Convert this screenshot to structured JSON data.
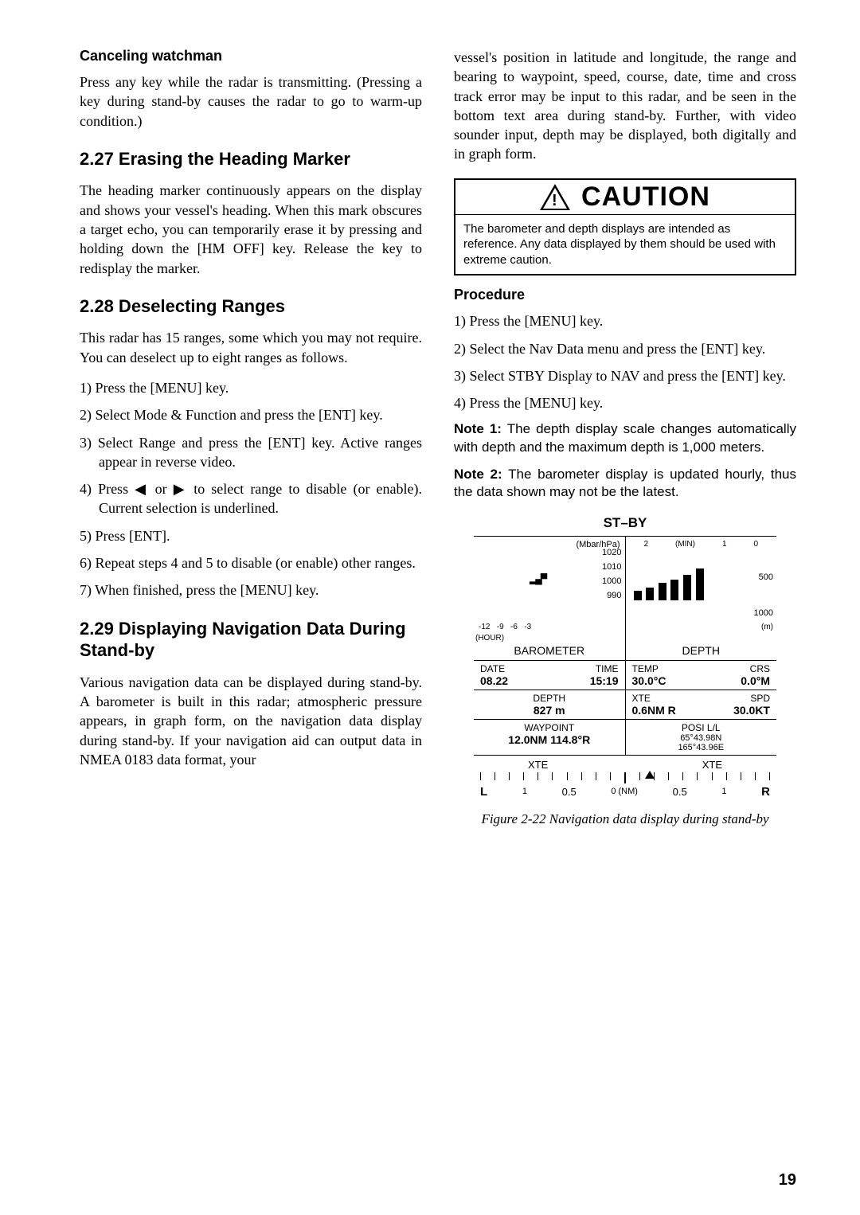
{
  "page_number": "19",
  "left": {
    "h_cancel": "Canceling watchman",
    "p_cancel": "Press any key while the radar is transmitting. (Pressing a key during stand-by causes the radar to go to warm-up condition.)",
    "h_227": "2.27 Erasing the Heading Marker",
    "p_227": "The heading marker continuously appears on the display and shows your vessel's heading. When this mark obscures a target echo, you can temporarily erase it by pressing and holding down the [HM OFF] key. Release the key to redisplay the marker.",
    "h_228": "2.28 Deselecting Ranges",
    "p_228": "This radar has 15 ranges, some which you may not require. You can deselect up to eight ranges as follows.",
    "li1": "1) Press the [MENU] key.",
    "li2": "2) Select Mode & Function and press the [ENT] key.",
    "li3": "3) Select Range and press the [ENT] key. Active ranges appear in reverse video.",
    "li4a": "4) Press ",
    "li4b": " or ",
    "li4c": " to select range to disable (or enable). Current selection is underlined.",
    "arrow_l": "◀",
    "arrow_r": "▶",
    "li5": "5) Press [ENT].",
    "li6": "6) Repeat steps 4 and 5 to disable (or enable) other ranges.",
    "li7": "7) When finished, press the [MENU] key.",
    "h_229": "2.29 Displaying Navigation Data During Stand-by",
    "p_229": "Various navigation data can be displayed during stand-by. A barometer is built in this radar; atmospheric pressure appears, in graph form, on the navigation data display during stand-by. If your navigation aid can output data in NMEA 0183 data format, your"
  },
  "right": {
    "p_cont": "vessel's position in latitude and longitude, the range and bearing to waypoint, speed, course, date, time and cross track error may be input to this radar, and be seen in the bottom text area during stand-by. Further, with video sounder input, depth may be displayed, both digitally and in graph form.",
    "caution_word": "CAUTION",
    "caution_body": "The barometer and depth displays are intended as reference. Any data displayed by them should be used with extreme caution.",
    "h_proc": "Procedure",
    "li1": "1) Press the [MENU] key.",
    "li2": "2) Select the Nav Data menu and press the [ENT] key.",
    "li3": "3) Select STBY Display to NAV and press the [ENT] key.",
    "li4": "4) Press the [MENU] key.",
    "note1_b": "Note 1:",
    "note1": " The depth display scale changes automatically with depth and the maximum depth is 1,000 meters.",
    "note2_b": "Note 2:",
    "note2": " The barometer display is updated hourly, thus the data shown may not be the latest.",
    "fig_title": "ST–BY",
    "caption": "Figure 2-22 Navigation data display during stand-by"
  },
  "nav": {
    "baro_unit": "(Mbar/hPa)",
    "baro_y": [
      "1020",
      "1010",
      "1000",
      "990"
    ],
    "baro_x": [
      "-12",
      "-9",
      "-6",
      "-3"
    ],
    "baro_hour": "(HOUR)",
    "baro_label": "BAROMETER",
    "depth_unit_top": "(MIN)",
    "depth_x": [
      "2",
      "1",
      "0"
    ],
    "depth_y": [
      "500",
      "1000"
    ],
    "depth_m": "(m)",
    "depth_label": "DEPTH",
    "row1": {
      "l1": "DATE",
      "l2": "TIME",
      "v1": "08.22",
      "v2": "15:19",
      "r1": "TEMP",
      "r2": "CRS",
      "rv1": "30.0°C",
      "rv2": "0.0°M"
    },
    "row2": {
      "l": "DEPTH",
      "v": "827 m",
      "r1": "XTE",
      "r2": "SPD",
      "rv1": "0.6NM R",
      "rv2": "30.0KT"
    },
    "row3": {
      "l": "WAYPOINT",
      "v": "12.0NM   114.8°R",
      "r1": "POSI   L/L",
      "r2": "65°43.98N",
      "r3": "165°43.96E"
    },
    "xte": {
      "lbl": "XTE",
      "L": "L",
      "R": "R",
      "n1": "1",
      "n05": "0.5",
      "mid": "0 (NM)"
    }
  }
}
